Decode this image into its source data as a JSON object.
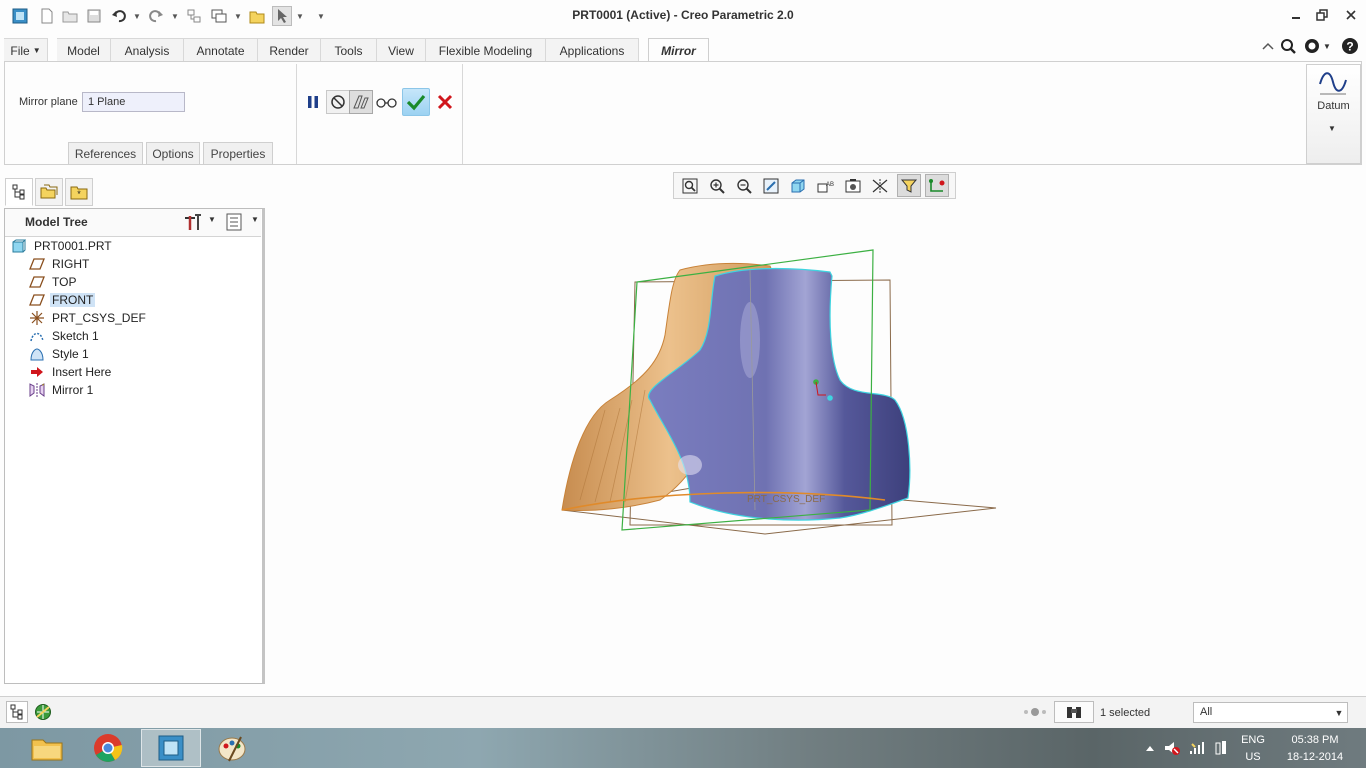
{
  "window": {
    "title": "PRT0001 (Active) - Creo Parametric 2.0"
  },
  "ribbon": {
    "tabs": [
      {
        "label": "File"
      },
      {
        "label": "Model"
      },
      {
        "label": "Analysis"
      },
      {
        "label": "Annotate"
      },
      {
        "label": "Render"
      },
      {
        "label": "Tools"
      },
      {
        "label": "View"
      },
      {
        "label": "Flexible Modeling"
      },
      {
        "label": "Applications"
      },
      {
        "label": "Mirror"
      }
    ],
    "active_tab": "Mirror",
    "mirror": {
      "plane_label": "Mirror plane",
      "plane_value": "1 Plane",
      "subtabs": [
        {
          "label": "References"
        },
        {
          "label": "Options"
        },
        {
          "label": "Properties"
        }
      ]
    },
    "datum_label": "Datum"
  },
  "model_tree": {
    "title": "Model Tree",
    "items": [
      {
        "label": "PRT0001.PRT",
        "icon": "part-icon"
      },
      {
        "label": "RIGHT",
        "icon": "datum-plane-icon"
      },
      {
        "label": "TOP",
        "icon": "datum-plane-icon"
      },
      {
        "label": "FRONT",
        "icon": "datum-plane-icon",
        "selected": true
      },
      {
        "label": "PRT_CSYS_DEF",
        "icon": "csys-icon"
      },
      {
        "label": "Sketch 1",
        "icon": "sketch-icon"
      },
      {
        "label": "Style 1",
        "icon": "style-icon"
      },
      {
        "label": "Insert Here",
        "icon": "insert-arrow-icon"
      },
      {
        "label": "Mirror 1",
        "icon": "mirror-icon"
      }
    ]
  },
  "viewport": {
    "csys_label": "PRT_CSYS_DEF"
  },
  "status": {
    "selected": "1 selected",
    "filter": "All"
  },
  "taskbar": {
    "lang": "ENG",
    "region": "US",
    "time": "05:38 PM",
    "date": "18-12-2014"
  },
  "colors": {
    "surface_blue": "#5c5f9e",
    "surface_orange": "#d9a46b",
    "datum_green": "#3cb043",
    "datum_brown": "#8a6a4a",
    "edge_cyan": "#3fd4e0"
  }
}
